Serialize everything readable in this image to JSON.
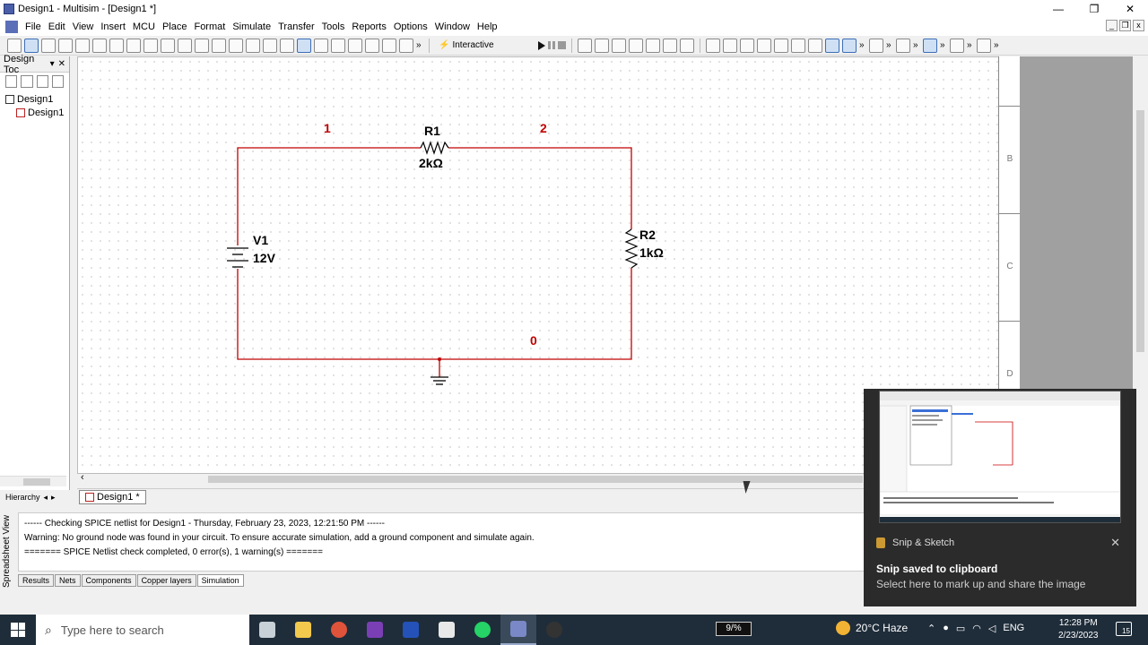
{
  "window": {
    "title": "Design1 - Multisim - [Design1 *]",
    "minimize": "—",
    "restore": "❐",
    "close": "✕"
  },
  "menu": [
    "File",
    "Edit",
    "View",
    "Insert",
    "MCU",
    "Place",
    "Format",
    "Simulate",
    "Transfer",
    "Tools",
    "Reports",
    "Options",
    "Window",
    "Help"
  ],
  "toolbar": {
    "mode_label": "Interactive",
    "more": "»"
  },
  "design_toolbox": {
    "title": "Design Toc",
    "close": "✕",
    "pin": "▾",
    "tree": [
      {
        "label": "Design1",
        "level": 0
      },
      {
        "label": "Design1",
        "level": 1
      }
    ],
    "tab_label": "Hierarchy",
    "nav_left": "◂",
    "nav_right": "▸"
  },
  "schematic": {
    "components": [
      {
        "ref": "R1",
        "value": "2kΩ"
      },
      {
        "ref": "R2",
        "value": "1kΩ"
      },
      {
        "ref": "V1",
        "value": "12V"
      }
    ],
    "nets": [
      "1",
      "2",
      "0"
    ],
    "colors": {
      "wire": "#c00000",
      "net_label": "#c00000",
      "component": "#000000"
    }
  },
  "border_zones": [
    "B",
    "C",
    "D"
  ],
  "scroll": {
    "left_arrow": "‹",
    "right_arrow": "›"
  },
  "document_tab": {
    "label": "Design1 *"
  },
  "output": {
    "side_label": "Spreadsheet View",
    "lines": [
      "------ Checking SPICE netlist for Design1 - Thursday, February 23, 2023, 12:21:50 PM ------",
      "Warning: No ground node was found in your circuit. To ensure accurate simulation, add a ground component and simulate again.",
      "======= SPICE Netlist check completed, 0 error(s), 1 warning(s) ======="
    ],
    "tabs": [
      "Results",
      "Nets",
      "Components",
      "Copper layers",
      "Simulation"
    ],
    "active_tab": "Simulation"
  },
  "snip": {
    "app_name": "Snip & Sketch",
    "title": "Snip saved to clipboard",
    "subtitle": "Select here to mark up and share the image",
    "close": "✕"
  },
  "taskbar": {
    "search_placeholder": "Type here to search",
    "cpu": "9/%",
    "weather": "20°C  Haze",
    "language": "ENG",
    "time": "12:28 PM",
    "date": "2/23/2023",
    "notifications": "15",
    "apps": [
      {
        "name": "task-view",
        "color": "#c8d0d8"
      },
      {
        "name": "file-explorer",
        "color": "#f2c94c"
      },
      {
        "name": "chrome",
        "color": "#e0533b"
      },
      {
        "name": "onenote",
        "color": "#7b3fb5"
      },
      {
        "name": "app-blue-orange",
        "color": "#2452b8"
      },
      {
        "name": "whiteboard",
        "color": "#e8e8e8"
      },
      {
        "name": "whatsapp",
        "color": "#25d366"
      },
      {
        "name": "multisim",
        "color": "#7a88c8"
      },
      {
        "name": "recorder",
        "color": "#333333"
      }
    ]
  }
}
